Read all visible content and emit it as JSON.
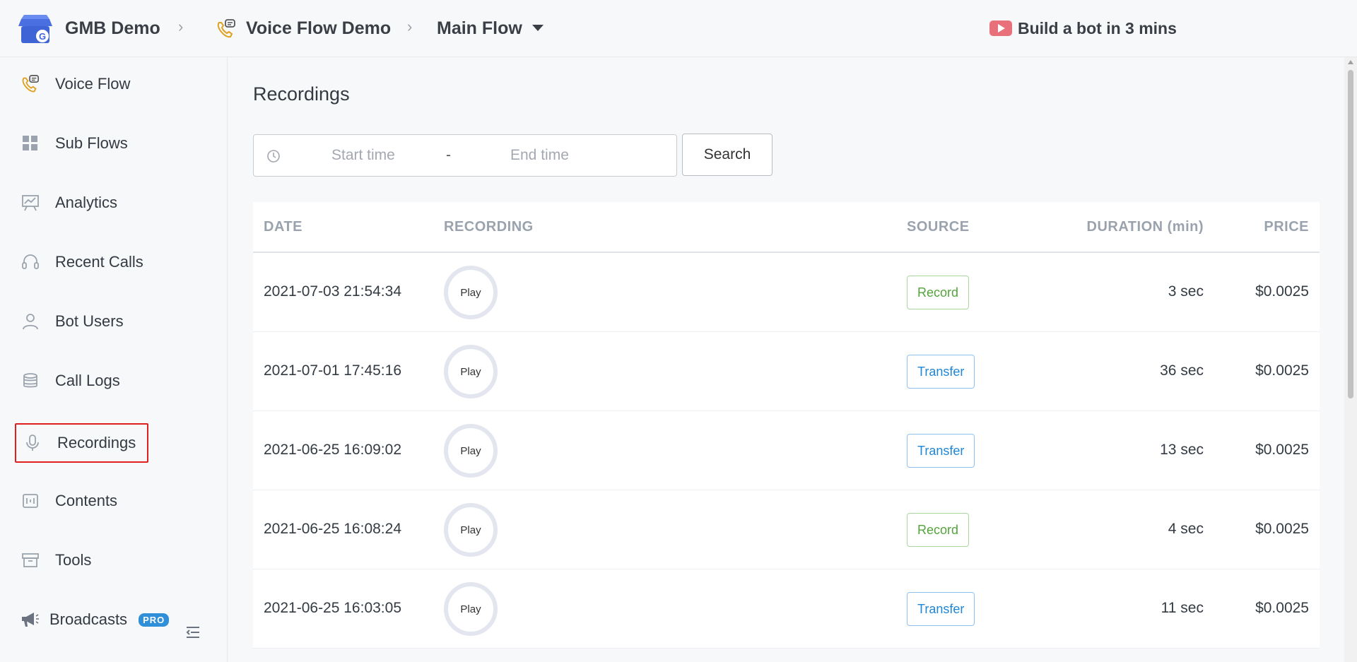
{
  "header": {
    "workspace": "GMB Demo",
    "bot": "Voice Flow Demo",
    "flow": "Main Flow",
    "promo": "Build a bot in 3 mins"
  },
  "sidebar": {
    "items": [
      {
        "label": "Voice Flow",
        "icon": "phone-chat-icon"
      },
      {
        "label": "Sub Flows",
        "icon": "grid-icon"
      },
      {
        "label": "Analytics",
        "icon": "chart-board-icon"
      },
      {
        "label": "Recent Calls",
        "icon": "headset-icon"
      },
      {
        "label": "Bot Users",
        "icon": "user-icon"
      },
      {
        "label": "Call Logs",
        "icon": "database-icon"
      },
      {
        "label": "Recordings",
        "icon": "microphone-icon"
      },
      {
        "label": "Contents",
        "icon": "content-icon"
      },
      {
        "label": "Tools",
        "icon": "archive-icon"
      },
      {
        "label": "Broadcasts",
        "icon": "megaphone-icon",
        "badge": "PRO"
      }
    ],
    "active": "Recordings"
  },
  "main": {
    "title": "Recordings",
    "filter": {
      "start_placeholder": "Start time",
      "separator": "-",
      "end_placeholder": "End time",
      "search_label": "Search"
    },
    "table": {
      "columns": [
        "DATE",
        "RECORDING",
        "SOURCE",
        "DURATION (min)",
        "PRICE"
      ],
      "rows": [
        {
          "date": "2021-07-03 21:54:34",
          "play": "Play",
          "source": "Record",
          "duration": "3 sec",
          "price": "$0.0025"
        },
        {
          "date": "2021-07-01 17:45:16",
          "play": "Play",
          "source": "Transfer",
          "duration": "36 sec",
          "price": "$0.0025"
        },
        {
          "date": "2021-06-25 16:09:02",
          "play": "Play",
          "source": "Transfer",
          "duration": "13 sec",
          "price": "$0.0025"
        },
        {
          "date": "2021-06-25 16:08:24",
          "play": "Play",
          "source": "Record",
          "duration": "4 sec",
          "price": "$0.0025"
        },
        {
          "date": "2021-06-25 16:03:05",
          "play": "Play",
          "source": "Transfer",
          "duration": "11 sec",
          "price": "$0.0025"
        }
      ]
    }
  },
  "colors": {
    "record_tag": "#52a43a",
    "transfer_tag": "#1f86d8",
    "active_outline": "#e02020",
    "pro_badge": "#2f8fd8",
    "promo_icon": "#e8707a"
  }
}
